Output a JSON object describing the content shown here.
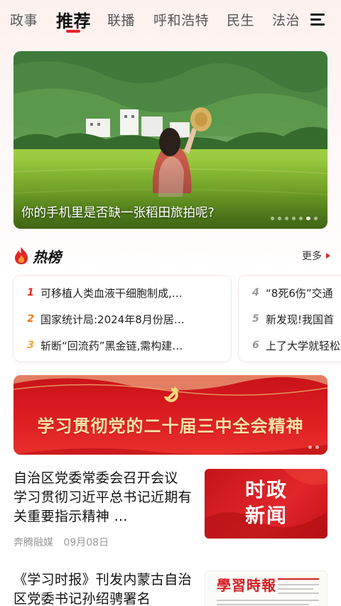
{
  "tabs": [
    "政事",
    "推荐",
    "联播",
    "呼和浩特",
    "民生",
    "法治"
  ],
  "active_tab": "推荐",
  "banner": {
    "caption": "你的手机里是否缺一张稻田旅拍呢?",
    "dot_count": 7,
    "active_dot": 6
  },
  "hot": {
    "title": "热榜",
    "more": "更多",
    "col1": [
      {
        "rank": "1",
        "text": "可移植人类血液干细胞制成,…"
      },
      {
        "rank": "2",
        "text": "国家统计局:2024年8月份居…"
      },
      {
        "rank": "3",
        "text": "斩断“回流药”黑金链,需构建…"
      }
    ],
    "col2": [
      {
        "rank": "4",
        "text": "“8死6伤”交通"
      },
      {
        "rank": "5",
        "text": "新发现!我国首"
      },
      {
        "rank": "6",
        "text": "上了大学就轻松"
      }
    ]
  },
  "red_banner": {
    "title": "学习贯彻党的二十届三中全会精神"
  },
  "articles": [
    {
      "title": "自治区党委常委会召开会议 学习贯彻习近平总书记近期有关重要指示精神 …",
      "source": "奔腾融媒",
      "date": "09月08日",
      "thumb_text": "时政新闻"
    },
    {
      "title": "《学习时报》刊发内蒙古自治区党委书记孙绍骋署名",
      "thumb_text": "學習時報"
    }
  ],
  "colors": {
    "accent": "#e0262b",
    "rank1": "#e0262b",
    "rank2": "#f07a1f",
    "rank3": "#f2a630",
    "gold_text": "#fde3a6"
  }
}
